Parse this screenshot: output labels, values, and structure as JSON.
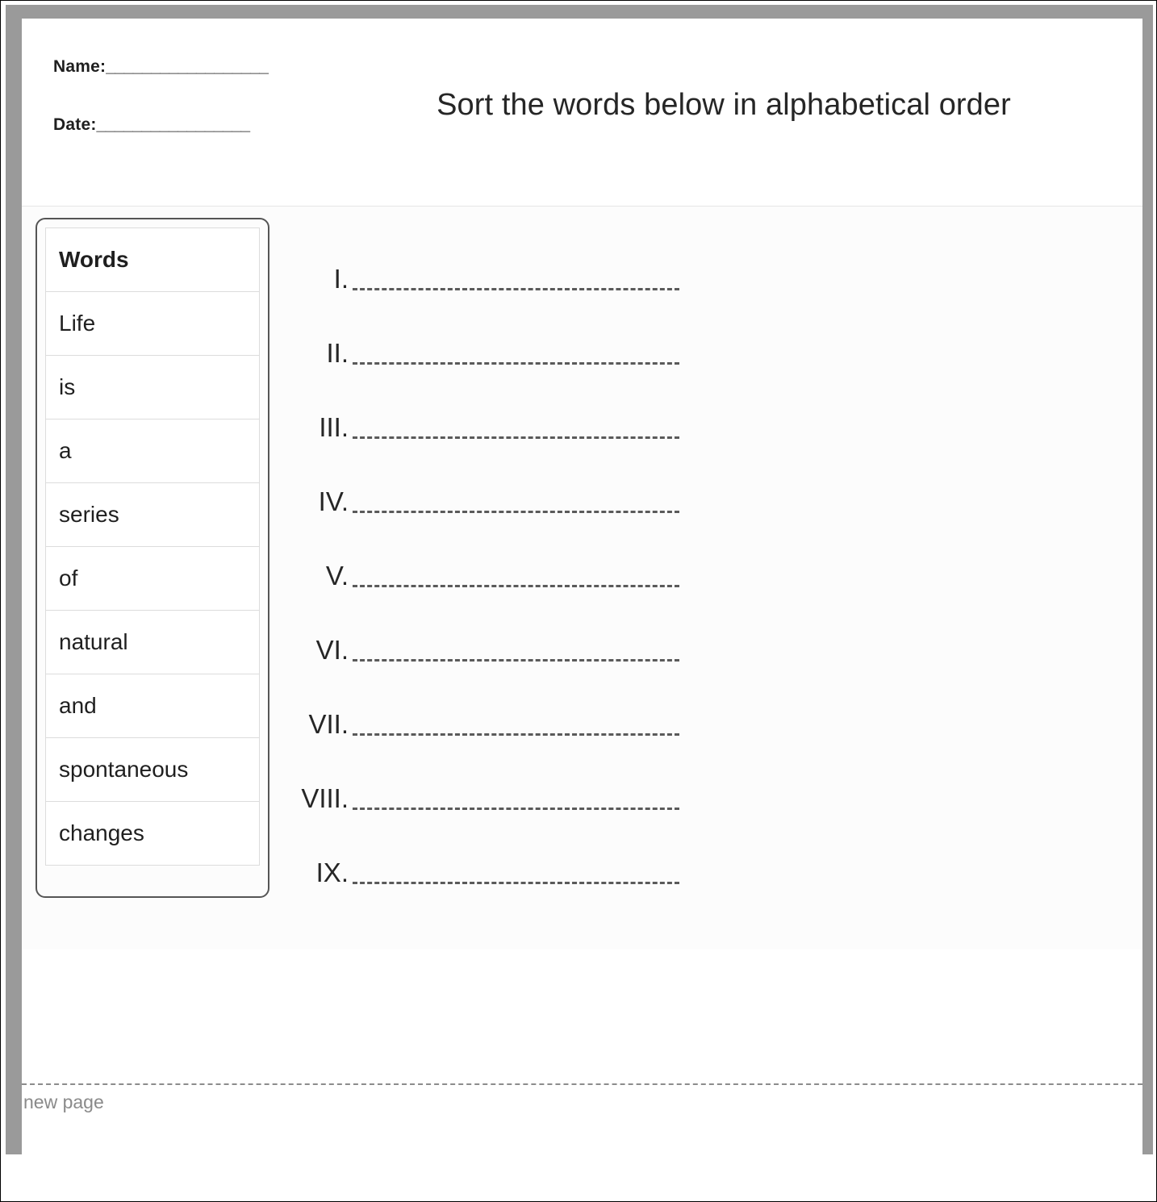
{
  "worksheet": {
    "title": "Sort the words below in alphabetical order",
    "fields": [
      {
        "label": "Name:",
        "rule": "__________________"
      },
      {
        "label": "Date:",
        "rule": "_________________"
      }
    ],
    "words_table": {
      "header": "Words",
      "rows": [
        "Life",
        "is",
        "a",
        "series",
        "of",
        "natural",
        "and",
        "spontaneous",
        "changes"
      ]
    },
    "answers": [
      {
        "numeral": "I.",
        "value": ""
      },
      {
        "numeral": "II.",
        "value": ""
      },
      {
        "numeral": "III.",
        "value": ""
      },
      {
        "numeral": "IV.",
        "value": ""
      },
      {
        "numeral": "V.",
        "value": ""
      },
      {
        "numeral": "VI.",
        "value": ""
      },
      {
        "numeral": "VII.",
        "value": ""
      },
      {
        "numeral": "VIII.",
        "value": ""
      },
      {
        "numeral": "IX.",
        "value": ""
      }
    ],
    "footer": {
      "new_page_label": "new page"
    },
    "colors": {
      "frame": "#9a9a9a",
      "page": "#ffffff",
      "body_tint": "#fcfcfc",
      "card_border": "#555555",
      "table_border": "#dcdcdc",
      "text": "#1f1f1f",
      "title_text": "#262626",
      "dashed_line": "#5a5a5a",
      "muted_text": "#8a8a8a"
    }
  }
}
